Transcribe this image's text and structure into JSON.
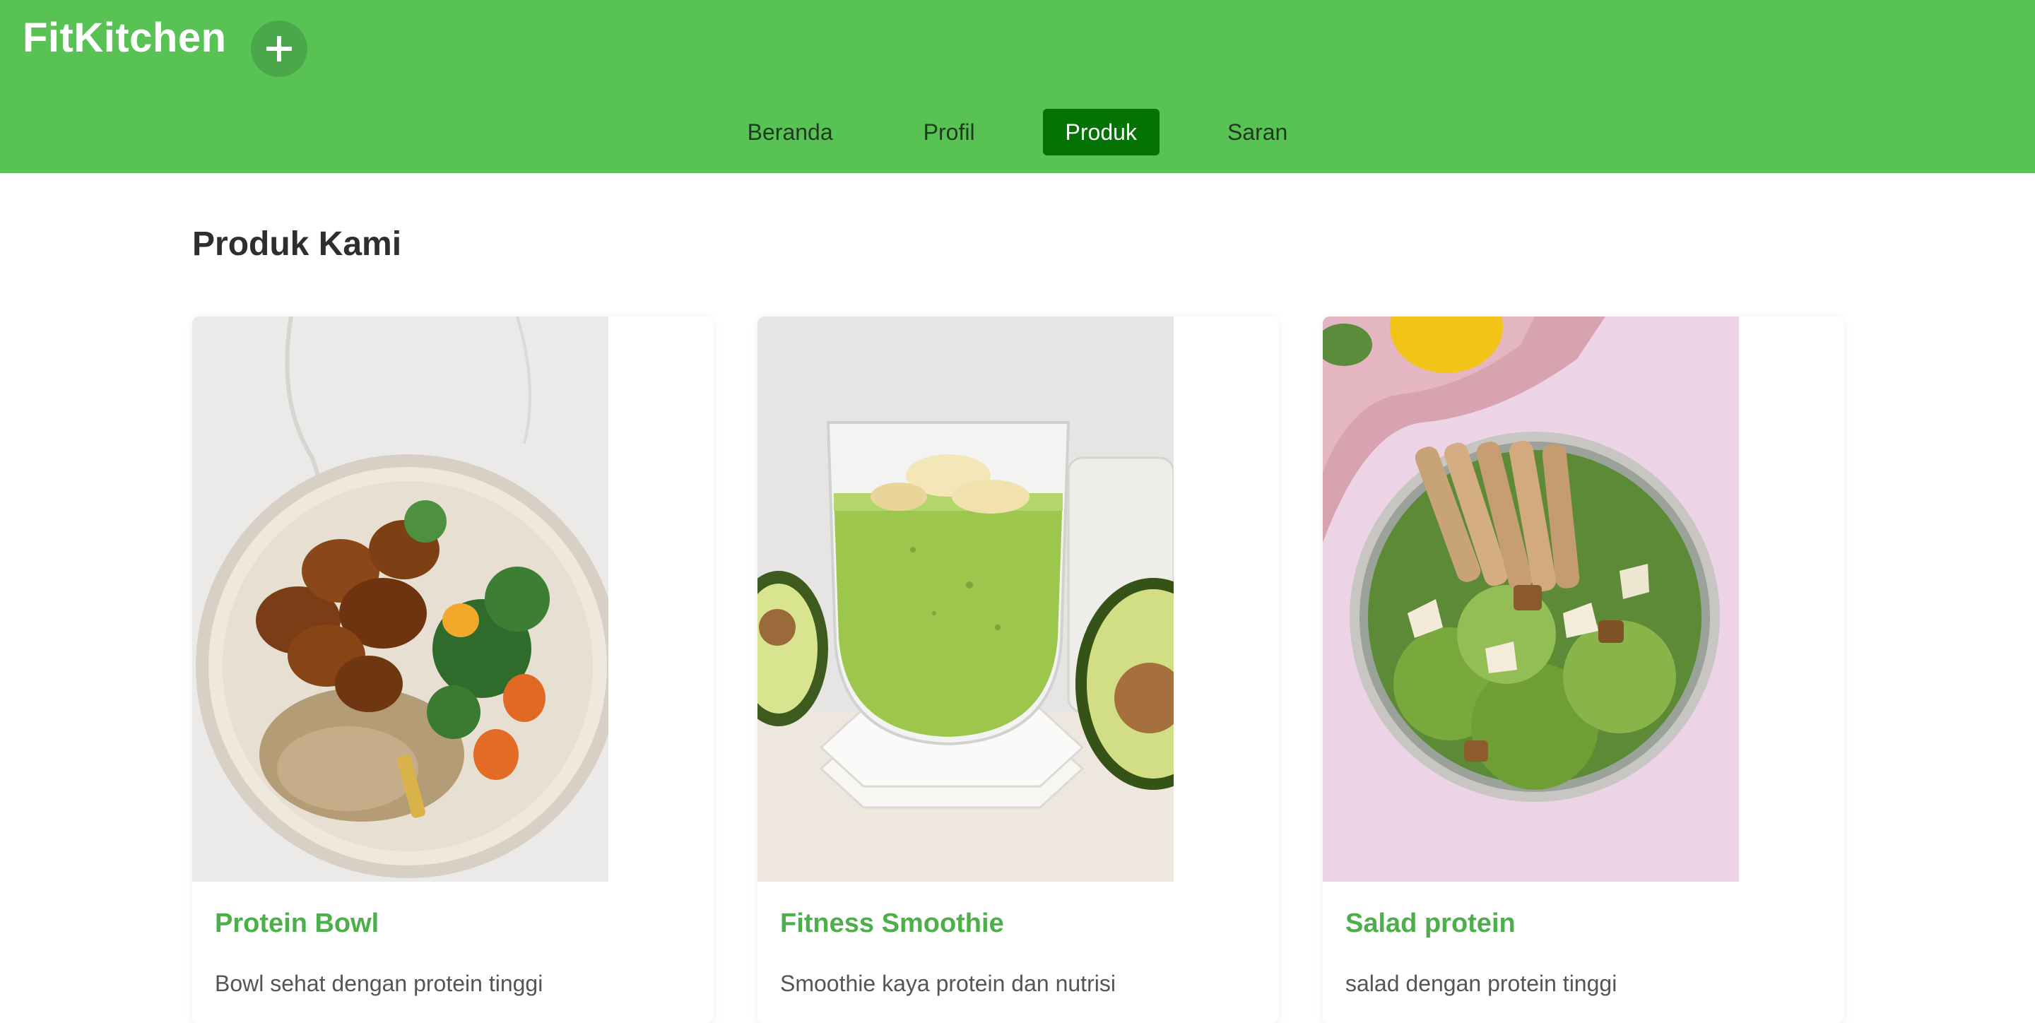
{
  "header": {
    "brand": "FitKitchen",
    "add_icon": "plus-icon",
    "background": "#58c255"
  },
  "nav": {
    "items": [
      {
        "label": "Beranda",
        "active": false
      },
      {
        "label": "Profil",
        "active": false
      },
      {
        "label": "Produk",
        "active": true
      },
      {
        "label": "Saran",
        "active": false
      }
    ],
    "active_color": "#047204"
  },
  "main": {
    "title": "Produk Kami",
    "products": [
      {
        "name": "Protein Bowl",
        "description": "Bowl sehat dengan protein tinggi",
        "image": "protein-bowl-photo"
      },
      {
        "name": "Fitness Smoothie",
        "description": "Smoothie kaya protein dan nutrisi",
        "image": "green-smoothie-photo"
      },
      {
        "name": "Salad protein",
        "description": "salad dengan protein tinggi",
        "image": "chicken-salad-photo"
      }
    ],
    "title_color": "#4caf4a"
  }
}
